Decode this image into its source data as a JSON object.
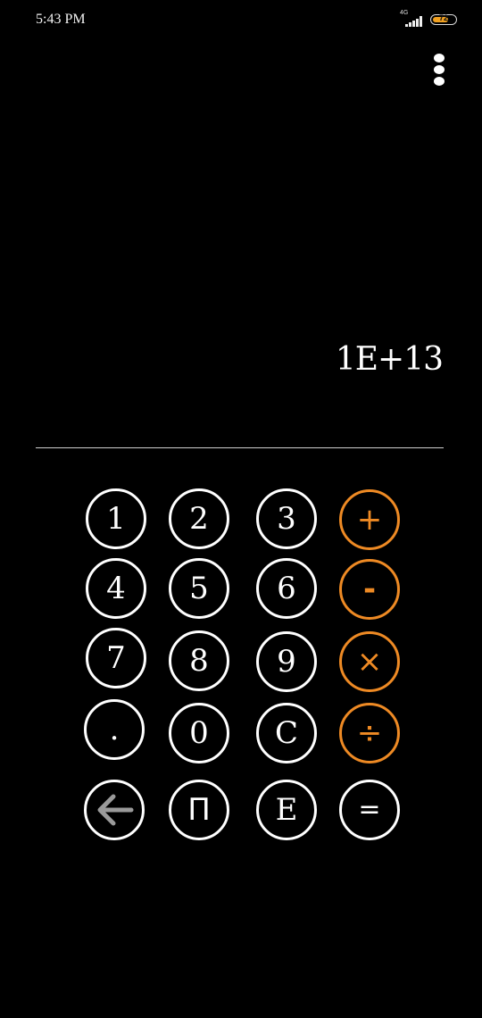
{
  "status_bar": {
    "time": "5:43 PM",
    "network": "4G",
    "battery": "72",
    "battery_level": 0.72
  },
  "menu": {
    "icon": "more-vert-icon"
  },
  "display": {
    "value": "1E+13"
  },
  "keypad": {
    "rows": [
      [
        "1",
        "2",
        "3",
        "+"
      ],
      [
        "4",
        "5",
        "6",
        "-"
      ],
      [
        "7",
        "8",
        "9",
        "×"
      ],
      [
        ".",
        "0",
        "C",
        "÷"
      ],
      [
        "backspace",
        "Π",
        "E",
        "="
      ]
    ],
    "backspace_icon": "arrow-left-icon"
  },
  "colors": {
    "background": "#000000",
    "key_border": "#ffffff",
    "operator": "#ee8a24",
    "backspace_arrow": "#9a9a9a"
  }
}
